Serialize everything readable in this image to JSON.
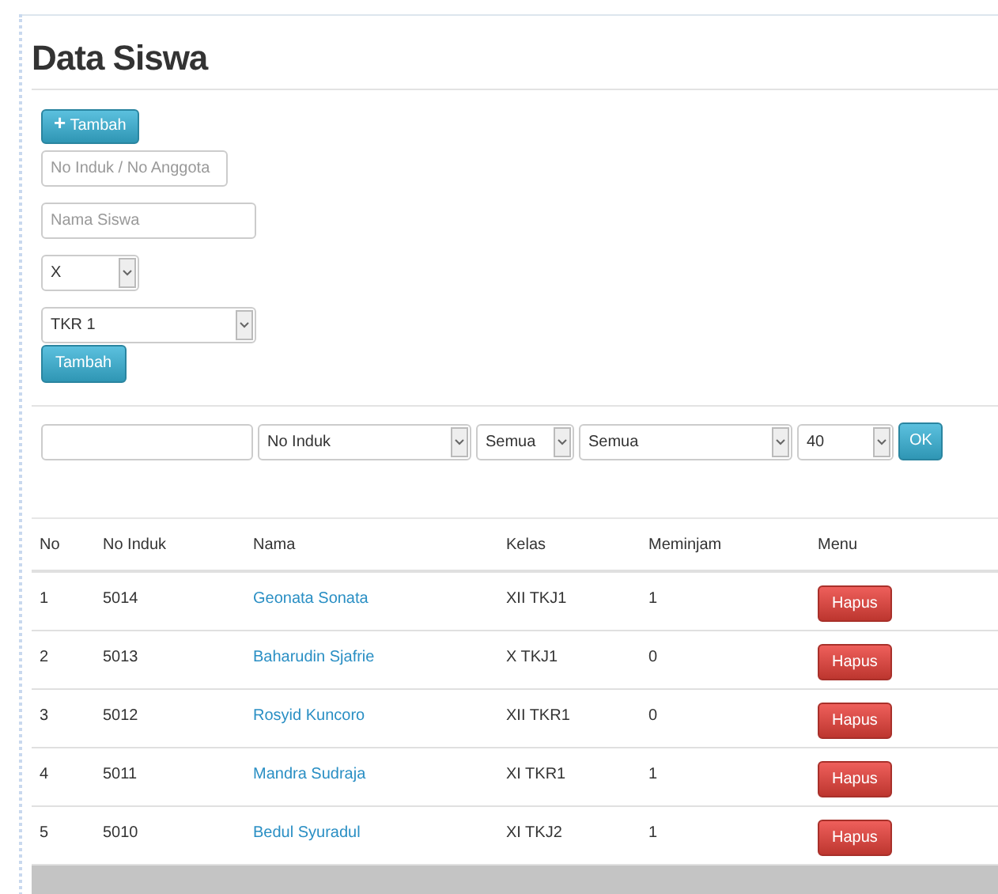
{
  "title": "Data Siswa",
  "add_button": {
    "icon": "+",
    "label": "Tambah"
  },
  "form": {
    "no_induk": {
      "placeholder": "No Induk / No Anggota"
    },
    "nama": {
      "placeholder": "Nama Siswa"
    },
    "kelas": {
      "value": "X"
    },
    "jurusan": {
      "value": "TKR 1"
    },
    "submit": "Tambah"
  },
  "filter": {
    "field": {
      "value": "No Induk"
    },
    "kelas": {
      "value": "Semua"
    },
    "jurusan": {
      "value": "Semua"
    },
    "limit": {
      "value": "40"
    },
    "submit": "OK"
  },
  "table": {
    "columns": [
      "No",
      "No Induk",
      "Nama",
      "Kelas",
      "Meminjam",
      "Menu"
    ],
    "rows": [
      {
        "no": "1",
        "no_induk": "5014",
        "nama": "Geonata Sonata",
        "kelas": "XII TKJ1",
        "meminjam": "1",
        "action": "Hapus"
      },
      {
        "no": "2",
        "no_induk": "5013",
        "nama": "Baharudin Sjafrie",
        "kelas": "X TKJ1",
        "meminjam": "0",
        "action": "Hapus"
      },
      {
        "no": "3",
        "no_induk": "5012",
        "nama": "Rosyid Kuncoro",
        "kelas": "XII TKR1",
        "meminjam": "0",
        "action": "Hapus"
      },
      {
        "no": "4",
        "no_induk": "5011",
        "nama": "Mandra Sudraja",
        "kelas": "XI TKR1",
        "meminjam": "1",
        "action": "Hapus"
      },
      {
        "no": "5",
        "no_induk": "5010",
        "nama": "Bedul Syuradul",
        "kelas": "XI TKJ2",
        "meminjam": "1",
        "action": "Hapus"
      }
    ]
  }
}
